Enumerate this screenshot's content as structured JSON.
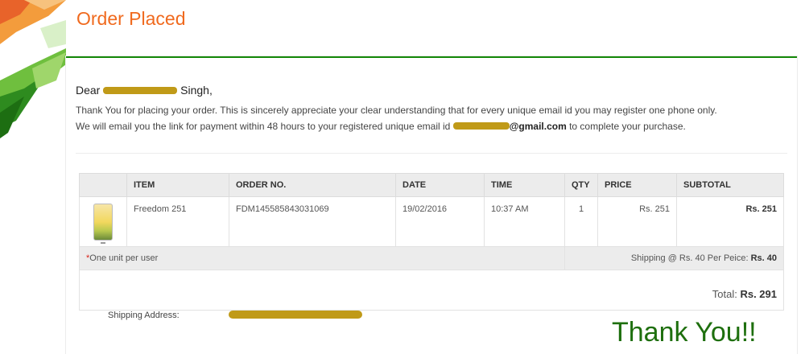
{
  "header": {
    "title": "Order Placed"
  },
  "greeting": {
    "prefix": "Dear",
    "name_suffix": "Singh,"
  },
  "message": {
    "line1": "Thank You for placing your order. This is sincerely appreciate your clear understanding that for every unique email id you may register one phone only.",
    "line2_prefix": "We will email you the link for payment within 48 hours to your registered unique email id",
    "email_domain": "@gmail.com",
    "line2_suffix": "to complete your purchase."
  },
  "order_table": {
    "columns": [
      "ITEM",
      "ORDER NO.",
      "DATE",
      "TIME",
      "QTY",
      "PRICE",
      "SUBTOTAL"
    ],
    "rows": [
      {
        "item": "Freedom 251",
        "order_no": "FDM145585843031069",
        "date": "19/02/2016",
        "time": "10:37 AM",
        "qty": "1",
        "price": "Rs. 251",
        "subtotal": "Rs. 251"
      }
    ],
    "note_star": "*",
    "note": "One unit per user",
    "shipping_label": "Shipping @ Rs. 40 Per Peice:",
    "shipping_value": "Rs. 40",
    "total_label": "Total:",
    "total_value": "Rs. 291"
  },
  "shipping": {
    "label": "Shipping Address:"
  },
  "footer": {
    "thanks": "Thank You!!"
  },
  "colors": {
    "title": "#f06a1e",
    "accent_line": "#138808",
    "thanks": "#1e6f0e",
    "redaction": "#c09a18"
  }
}
